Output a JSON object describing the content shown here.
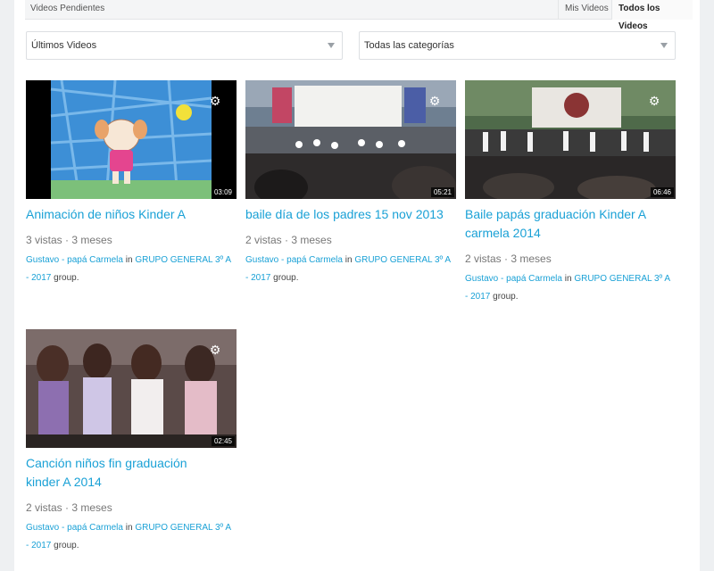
{
  "tabs": {
    "pending_label": "Videos Pendientes",
    "mine_label": "Mis Videos",
    "all_label": "Todos los Videos"
  },
  "filters": {
    "sort_selected": "Últimos Videos",
    "category_selected": "Todas las categorías"
  },
  "videos": [
    {
      "title_lines": [
        "Animación de niños Kinder A"
      ],
      "duration": "03:09",
      "views": "3 vistas",
      "age": "3 meses",
      "author": "Gustavo - papá Carmela",
      "in": "in",
      "group_line1": "GRUPO GENERAL 3º A",
      "group_line2": "- 2017",
      "group_suffix": "group."
    },
    {
      "title_lines": [
        "baile día de los padres 15 nov 2013"
      ],
      "duration": "05:21",
      "views": "2 vistas",
      "age": "3 meses",
      "author": "Gustavo - papá Carmela",
      "in": "in",
      "group_line1": "GRUPO GENERAL 3º A",
      "group_line2": "- 2017",
      "group_suffix": "group."
    },
    {
      "title_lines": [
        "Baile papás graduación Kinder A",
        "carmela 2014"
      ],
      "duration": "06:46",
      "views": "2 vistas",
      "age": "3 meses",
      "author": "Gustavo - papá Carmela",
      "in": "in",
      "group_line1": "GRUPO GENERAL 3º A",
      "group_line2": "- 2017",
      "group_suffix": "group."
    },
    {
      "title_lines": [
        "Canción niños fin graduación",
        "kinder A 2014"
      ],
      "duration": "02:45",
      "views": "2 vistas",
      "age": "3 meses",
      "author": "Gustavo - papá Carmela",
      "in": "in",
      "group_line1": "GRUPO GENERAL 3º A",
      "group_line2": "- 2017",
      "group_suffix": "group."
    }
  ],
  "colors": {
    "link": "#1aa1d6",
    "background": "#eef0f2"
  },
  "icons": {
    "thumbnail_action": "gear-icon",
    "select_arrow": "chevron-down-icon"
  }
}
